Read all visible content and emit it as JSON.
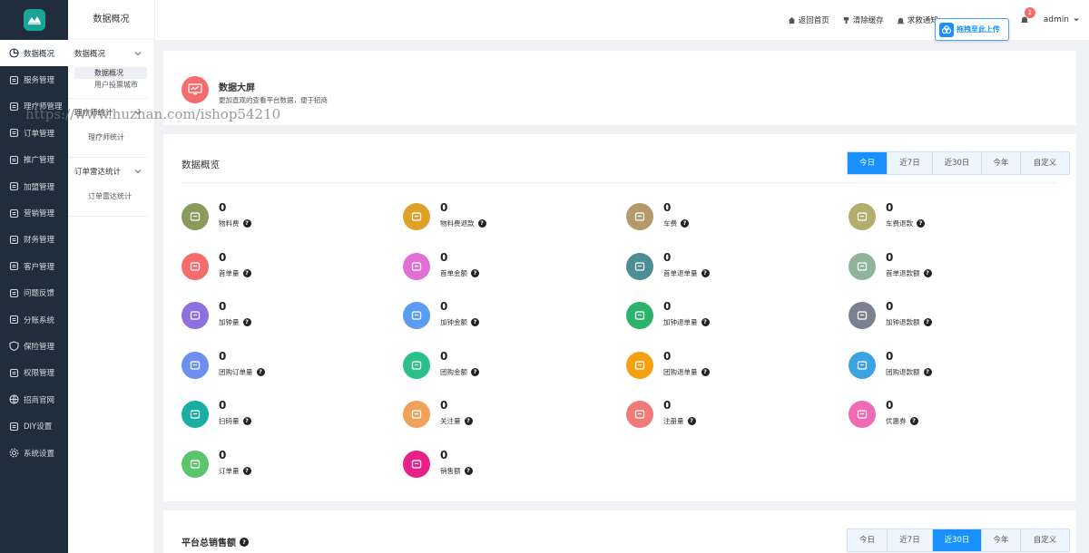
{
  "sidebar": {
    "items": [
      {
        "label": "数据概况",
        "icon": "pie-chart-icon",
        "active": true
      },
      {
        "label": "服务管理",
        "icon": "server-icon"
      },
      {
        "label": "理疗师管理",
        "icon": "user-group-icon"
      },
      {
        "label": "订单管理",
        "icon": "order-icon"
      },
      {
        "label": "推广管理",
        "icon": "promotion-icon"
      },
      {
        "label": "加盟管理",
        "icon": "franchise-icon"
      },
      {
        "label": "营销管理",
        "icon": "marketing-icon"
      },
      {
        "label": "财务管理",
        "icon": "finance-icon"
      },
      {
        "label": "客户管理",
        "icon": "customer-icon"
      },
      {
        "label": "问题反馈",
        "icon": "feedback-icon"
      },
      {
        "label": "分账系统",
        "icon": "split-account-icon"
      },
      {
        "label": "保险管理",
        "icon": "shield-icon"
      },
      {
        "label": "权限管理",
        "icon": "permission-icon"
      },
      {
        "label": "招商官网",
        "icon": "globe-icon"
      },
      {
        "label": "DIY设置",
        "icon": "diy-icon"
      },
      {
        "label": "系统设置",
        "icon": "gear-icon"
      }
    ]
  },
  "submenu": {
    "title": "数据概况",
    "groups": [
      {
        "label": "数据概况",
        "items": [
          "数据概况",
          "用户投票城市"
        ]
      },
      {
        "label": "理疗师统计",
        "items": [
          "理疗师统计"
        ]
      },
      {
        "label": "订单雷达统计",
        "items": [
          "订单雷达统计"
        ]
      }
    ]
  },
  "header": {
    "links": [
      "返回首页",
      "清除缓存",
      "求救通知"
    ],
    "notification_count": "1",
    "user": "admin",
    "upload_label": "拖拽至此上传"
  },
  "screen": {
    "title": "数据大屏",
    "desc": "更加直观的查看平台数据，便于招商"
  },
  "overview": {
    "title": "数据概览",
    "tabs": [
      "今日",
      "近7日",
      "近30日",
      "今年",
      "自定义"
    ],
    "active_tab": 0,
    "stats": [
      {
        "label": "物料费",
        "value": "0",
        "color": "#8a9a5b"
      },
      {
        "label": "物料费退款",
        "value": "0",
        "color": "#e0a12a"
      },
      {
        "label": "车费",
        "value": "0",
        "color": "#b49a6a"
      },
      {
        "label": "车费退款",
        "value": "0",
        "color": "#b3ad6e"
      },
      {
        "label": "首单量",
        "value": "0",
        "color": "#f56c6c"
      },
      {
        "label": "首单金额",
        "value": "0",
        "color": "#e06fd6"
      },
      {
        "label": "首单退单量",
        "value": "0",
        "color": "#4c8e93"
      },
      {
        "label": "首单退款额",
        "value": "0",
        "color": "#8eb49a"
      },
      {
        "label": "加钟量",
        "value": "0",
        "color": "#8d6fe0"
      },
      {
        "label": "加钟金额",
        "value": "0",
        "color": "#5b9cf0"
      },
      {
        "label": "加钟退单量",
        "value": "0",
        "color": "#2bb36b"
      },
      {
        "label": "加钟退款额",
        "value": "0",
        "color": "#7a8291"
      },
      {
        "label": "团购订单量",
        "value": "0",
        "color": "#6c8ff0"
      },
      {
        "label": "团购金额",
        "value": "0",
        "color": "#2bc08a"
      },
      {
        "label": "团购退单量",
        "value": "0",
        "color": "#f5a010"
      },
      {
        "label": "团购退款额",
        "value": "0",
        "color": "#3aa3e0"
      },
      {
        "label": "扫码量",
        "value": "0",
        "color": "#1aaea3"
      },
      {
        "label": "关注量",
        "value": "0",
        "color": "#f0a15a"
      },
      {
        "label": "注册量",
        "value": "0",
        "color": "#f07a7a"
      },
      {
        "label": "优惠券",
        "value": "0",
        "color": "#f06ab5"
      },
      {
        "label": "订单量",
        "value": "0",
        "color": "#5cc46b"
      },
      {
        "label": "销售额",
        "value": "0",
        "color": "#e8208a"
      }
    ]
  },
  "sales": {
    "title": "平台总销售额",
    "tabs": [
      "今日",
      "近7日",
      "近30日",
      "今年",
      "自定义"
    ],
    "active_tab": 2
  },
  "watermark": "https://www.huzhan.com/ishop54210"
}
